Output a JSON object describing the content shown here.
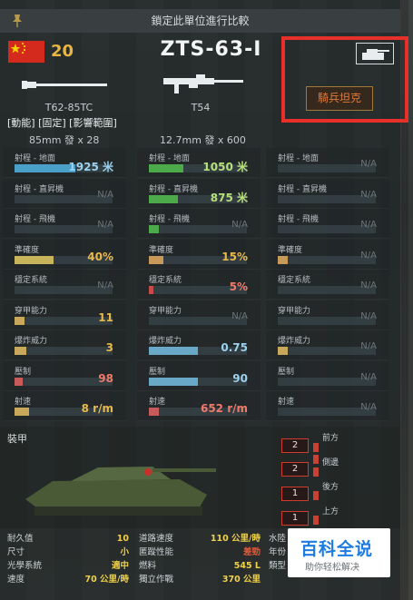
{
  "title_bar": {
    "text": "鎖定此單位進行比較"
  },
  "header": {
    "tier": "20",
    "unit_name": "ZTS-63-I",
    "unit_class": "騎兵坦克",
    "flag_colors": [
      "#d42a1e",
      "#f3d300"
    ]
  },
  "weapons": [
    {
      "name": "T62-85TC",
      "ammo": "85mm 發 x 28"
    },
    {
      "name": "T54",
      "ammo": "12.7mm 發 x 600"
    }
  ],
  "weapon_tags": "[動能] [固定] [影響範圍]",
  "stats": [
    {
      "label": "射程 - 地面",
      "cols": [
        {
          "value": "1925 米",
          "fill": 0.62,
          "color": "#4aa0c8"
        },
        {
          "value": "1050 米",
          "fill": 0.35,
          "color": "#4caa4a"
        },
        {
          "value": "N/A",
          "fill": 0,
          "color": ""
        }
      ]
    },
    {
      "label": "射程 - 直昇機",
      "cols": [
        {
          "value": "N/A",
          "fill": 0,
          "color": ""
        },
        {
          "value": "875 米",
          "fill": 0.3,
          "color": "#4caa4a"
        },
        {
          "value": "N/A",
          "fill": 0,
          "color": ""
        }
      ]
    },
    {
      "label": "射程 - 飛機",
      "cols": [
        {
          "value": "N/A",
          "fill": 0,
          "color": ""
        },
        {
          "value": "N/A",
          "fill": 0.1,
          "color": "#4caa4a"
        },
        {
          "value": "N/A",
          "fill": 0,
          "color": ""
        }
      ]
    },
    {
      "label": "準確度",
      "cols": [
        {
          "value": "40%",
          "fill": 0.4,
          "color": "#c8b45a"
        },
        {
          "value": "15%",
          "fill": 0.15,
          "color": "#c89a5a"
        },
        {
          "value": "N/A",
          "fill": 0.1,
          "color": "#c89a5a"
        }
      ]
    },
    {
      "label": "穩定系統",
      "cols": [
        {
          "value": "N/A",
          "fill": 0,
          "color": ""
        },
        {
          "value": "5%",
          "fill": 0.05,
          "color": "#c84a4a"
        },
        {
          "value": "N/A",
          "fill": 0,
          "color": ""
        }
      ]
    },
    {
      "label": "穿甲能力",
      "cols": [
        {
          "value": "11",
          "fill": 0.1,
          "color": "#c8a85a"
        },
        {
          "value": "N/A",
          "fill": 0,
          "color": ""
        },
        {
          "value": "N/A",
          "fill": 0,
          "color": ""
        }
      ]
    },
    {
      "label": "爆炸威力",
      "cols": [
        {
          "value": "3",
          "fill": 0.12,
          "color": "#c8a85a"
        },
        {
          "value": "0.75",
          "fill": 0.5,
          "color": "#6aa8c8"
        },
        {
          "value": "N/A",
          "fill": 0.1,
          "color": "#c8a85a"
        }
      ]
    },
    {
      "label": "壓制",
      "cols": [
        {
          "value": "98",
          "fill": 0.08,
          "color": "#c85a5a"
        },
        {
          "value": "90",
          "fill": 0.5,
          "color": "#6aa8c8"
        },
        {
          "value": "N/A",
          "fill": 0,
          "color": ""
        }
      ]
    },
    {
      "label": "射速",
      "cols": [
        {
          "value": "8 r/m",
          "fill": 0.15,
          "color": "#c8a85a"
        },
        {
          "value": "652 r/m",
          "fill": 0.1,
          "color": "#c85a5a"
        },
        {
          "value": "N/A",
          "fill": 0,
          "color": ""
        }
      ]
    }
  ],
  "stat_label_3": {
    "aa": "射程 - 地面",
    "bb": "射程 - 直昇機",
    "cc": "射程 - 飛機"
  },
  "armor": {
    "label": "裝甲",
    "values": [
      {
        "side": "前方",
        "value": "2"
      },
      {
        "side": "側邊",
        "value": "2"
      },
      {
        "side": "後方",
        "value": "1"
      },
      {
        "side": "上方",
        "value": "1"
      }
    ]
  },
  "bottom_stats": [
    {
      "label": "耐久值",
      "value": "10",
      "label2": "道路速度",
      "value2": "110 公里/時",
      "label3": "水陸"
    },
    {
      "label": "尺寸",
      "value": "小",
      "label2": "匿蹤性能",
      "value2": "差勁",
      "label3": "年份"
    },
    {
      "label": "光學系統",
      "value": "適中",
      "label2": "燃料",
      "value2": "545 L",
      "label3": "類型"
    },
    {
      "label": "速度",
      "value": "70 公里/時",
      "label2": "獨立作戰",
      "value2": "370 公里",
      "label3": ""
    }
  ],
  "watermark": {
    "big": "百科全说",
    "small": "助你轻松解决"
  }
}
